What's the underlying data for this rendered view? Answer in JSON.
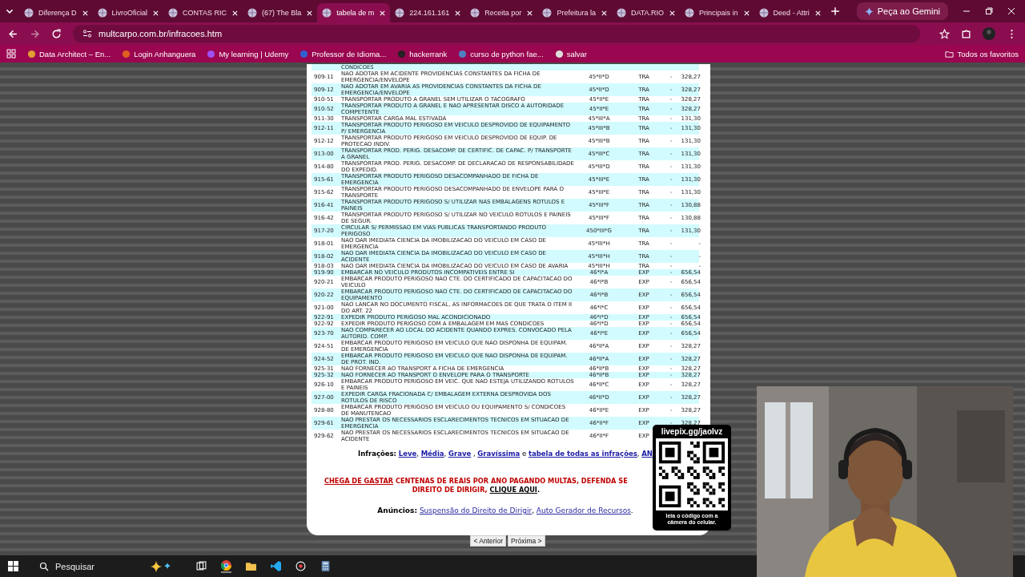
{
  "browser": {
    "tabs": [
      {
        "title": "Diferença D",
        "selected": false
      },
      {
        "title": "LivroOficial",
        "selected": false
      },
      {
        "title": "CONTAS RIC",
        "selected": false
      },
      {
        "title": "(67) The Bla",
        "selected": false
      },
      {
        "title": "tabela de m",
        "selected": true
      },
      {
        "title": "224.161.161",
        "selected": false
      },
      {
        "title": "Receita por",
        "selected": false
      },
      {
        "title": "Prefeitura la",
        "selected": false
      },
      {
        "title": "DATA.RIO",
        "selected": false
      },
      {
        "title": "Principais in",
        "selected": false
      },
      {
        "title": "Deed - Attri",
        "selected": false
      }
    ],
    "gemini_button": "Peça ao Gemini",
    "address": "multcarpo.com.br/infracoes.htm",
    "bookmarks": [
      "Data Architect – En...",
      "Login Anhanguera",
      "My learning | Udemy",
      "Professor de Idioma...",
      "hackerrank",
      "curso de python fae...",
      "salvar"
    ],
    "all_bookmarks": "Todos os favoritos"
  },
  "page": {
    "partial_line": "CONDICOES",
    "rows": [
      {
        "code": "909-11",
        "description": "NAO ADOTAR EM ACIDENTE PROVIDENCIAS CONSTANTES DA FICHA DE EMERGENCIA/ENVELOPE",
        "article": "45*II*D",
        "column_4": "TRA",
        "column_5": "-",
        "value": "328,27"
      },
      {
        "code": "909-12",
        "description": "NAO ADOTAR EM AVARIA AS PROVIDENCIAS CONSTANTES DA FICHA DE EMERGENCIA/ENVELOPE",
        "article": "45*II*D",
        "column_4": "TRA",
        "column_5": "-",
        "value": "328,27"
      },
      {
        "code": "910-51",
        "description": "TRANSPORTAR PRODUTO A GRANEL SEM UTILIZAR O TACOGRAFO",
        "article": "45*II*E",
        "column_4": "TRA",
        "column_5": "-",
        "value": "328,27"
      },
      {
        "code": "910-52",
        "description": "TRANSPORTAR PRODUTO A GRANEL E NAO APRESENTAR DISCO A AUTORIDADE COMPETENTE",
        "article": "45*II*E",
        "column_4": "TRA",
        "column_5": "-",
        "value": "328,27"
      },
      {
        "code": "911-30",
        "description": "TRANSPORTAR CARGA MAL ESTIVADA",
        "article": "45*III*A",
        "column_4": "TRA",
        "column_5": "-",
        "value": "131,30"
      },
      {
        "code": "912-11",
        "description": "TRANSPORTAR PRODUTO PERIGOSO EM VEICULO DESPROVIDO DE EQUIPAMENTO P/ EMERGENCIA",
        "article": "45*III*B",
        "column_4": "TRA",
        "column_5": "-",
        "value": "131,30"
      },
      {
        "code": "912-12",
        "description": "TRANSPORTAR PRODUTO PERIGOSO EM VEICULO DESPROVIDO DE EQUIP. DE PROTECAO INDIV.",
        "article": "45*III*B",
        "column_4": "TRA",
        "column_5": "-",
        "value": "131,30"
      },
      {
        "code": "913-00",
        "description": "TRANSPORTAR PROD. PERIG. DESACOMP. DE CERTIFIC. DE CAPAC. P/ TRANSPORTE A GRANEL",
        "article": "45*III*C",
        "column_4": "TRA",
        "column_5": "-",
        "value": "131,30"
      },
      {
        "code": "914-80",
        "description": "TRANSPORTAR PROD. PERIG. DESACOMP. DE DECLARACAO DE RESPONSABILIDADE DO EXPEDID.",
        "article": "45*III*D",
        "column_4": "TRA",
        "column_5": "-",
        "value": "131,30"
      },
      {
        "code": "915-61",
        "description": "TRANSPORTAR PRODUTO PERIGOSO DESACOMPANHADO DE FICHA DE EMERGENCIA",
        "article": "45*III*E",
        "column_4": "TRA",
        "column_5": "-",
        "value": "131,30"
      },
      {
        "code": "915-62",
        "description": "TRANSPORTAR PRODUTO PERIGOSO DESACOMPANHADO DE ENVELOPE PARA O TRANSPORTE",
        "article": "45*III*E",
        "column_4": "TRA",
        "column_5": "-",
        "value": "131,30"
      },
      {
        "code": "916-41",
        "description": "TRANSPORTAR PRODUTO PERIGOSO S/ UTILIZAR NAS EMBALAGENS ROTULOS E PAINEIS",
        "article": "45*III*F",
        "column_4": "TRA",
        "column_5": "-",
        "value": "130,88"
      },
      {
        "code": "916-42",
        "description": "TRANSPORTAR PRODUTO PERIGOSO S/ UTILIZAR NO VEICULO ROTULOS E PAINEIS DE SEGUR.",
        "article": "45*III*F",
        "column_4": "TRA",
        "column_5": "-",
        "value": "130,88"
      },
      {
        "code": "917-20",
        "description": "CIRCULAR S/ PERMISSAO EM VIAS PUBLICAS TRANSPORTANDO PRODUTO PERIGOSO",
        "article": "450*III*G",
        "column_4": "TRA",
        "column_5": "-",
        "value": "131,30"
      },
      {
        "code": "918-01",
        "description": "NAO DAR IMEDIATA CIENCIA DA IMOBILIZACAO DO VEICULO EM CASO DE EMERGENCIA",
        "article": "45*III*H",
        "column_4": "TRA",
        "column_5": "-",
        "value": "-"
      },
      {
        "code": "918-02",
        "description": "NAO DAR IMEDIATA CIENCIA DA IMOBILIZACAO DO VEICULO EM CASO DE ACIDENTE",
        "article": "45*III*H",
        "column_4": "TRA",
        "column_5": "-",
        "value": "-"
      },
      {
        "code": "918-03",
        "description": "NAO DAR IMEDIATA CIENCIA DA IMOBILIZACAO DO VEICULO EM CASO DE AVARIA",
        "article": "45*III*H",
        "column_4": "TRA",
        "column_5": "-",
        "value": "-"
      },
      {
        "code": "919-90",
        "description": "EMBARCAR NO VEICULO PRODUTOS INCOMPATIVEIS ENTRE SI",
        "article": "46*I*A",
        "column_4": "EXP",
        "column_5": "-",
        "value": "656,54"
      },
      {
        "code": "920-21",
        "description": "EMBARCAR PRODUTO PERIGOSO NAO CTE. DO CERTIFICADO DE CAPACITACAO DO VEICULO",
        "article": "46*I*B",
        "column_4": "EXP",
        "column_5": "-",
        "value": "656,54"
      },
      {
        "code": "920-22",
        "description": "EMBARCAR PRODUTO PERIGOSO NAO CTE. DO CERTIFICADO DE CAPACITACAO DO EQUIPAMENTO",
        "article": "46*I*B",
        "column_4": "EXP",
        "column_5": "-",
        "value": "656,54"
      },
      {
        "code": "921-00",
        "description": "NAO LANCAR NO DOCUMENTO FISCAL, AS INFORMACOES DE QUE TRATA O ITEM II DO ART. 22",
        "article": "46*I*C",
        "column_4": "EXP",
        "column_5": "-",
        "value": "656,54"
      },
      {
        "code": "922-91",
        "description": "EXPEDIR PRODUTO PERIGOSO MAL ACONDICIONADO",
        "article": "46*I*D",
        "column_4": "EXP",
        "column_5": "-",
        "value": "656,54"
      },
      {
        "code": "922-92",
        "description": "EXPEDIR PRODUTO PERIGOSO COM A EMBALAGEM EM MAS CONDICOES",
        "article": "46*I*D",
        "column_4": "EXP",
        "column_5": "-",
        "value": "656,54"
      },
      {
        "code": "923-70",
        "description": "NAO COMPARECER AO LOCAL DO ACIDENTE QUANDO EXPRES. CONVOCADO PELA AUTORID. COMP.",
        "article": "46*I*E",
        "column_4": "EXP",
        "column_5": "-",
        "value": "656,54"
      },
      {
        "code": "924-51",
        "description": "EMBARCAR PRODUTO PERIGOSO EM VEICULO QUE NAO DISPONHA DE EQUIPAM. DE EMERGENCIA",
        "article": "46*II*A",
        "column_4": "EXP",
        "column_5": "-",
        "value": "328,27"
      },
      {
        "code": "924-52",
        "description": "EMBARCAR PRODUTO PERIGOSO EM VEICULO QUE NAO DISPONHA DE EQUIPAM. DE PROT. IND.",
        "article": "46*II*A",
        "column_4": "EXP",
        "column_5": "-",
        "value": "328,27"
      },
      {
        "code": "925-31",
        "description": "NAO FORNECER AO TRANSPORT A FICHA DE EMERGENCIA",
        "article": "46*II*B",
        "column_4": "EXP",
        "column_5": "-",
        "value": "328,27"
      },
      {
        "code": "925-32",
        "description": "NAO FORNECER AO TRANSPORT O ENVELOPE PARA O TRANSPORTE",
        "article": "46*II*B",
        "column_4": "EXP",
        "column_5": "-",
        "value": "328,27"
      },
      {
        "code": "926-10",
        "description": "EMBARCAR PRODUTO PERIGOSO EM VEIC. QUE NAO ESTEJA UTILIZANDO ROTULOS E PAINEIS",
        "article": "46*II*C",
        "column_4": "EXP",
        "column_5": "-",
        "value": "328,27"
      },
      {
        "code": "927-00",
        "description": "EXPEDIR CARGA FRACIONADA C/ EMBALAGEM EXTERNA DESPROVIDA DOS ROTULOS DE RISCO",
        "article": "46*II*D",
        "column_4": "EXP",
        "column_5": "-",
        "value": "328,27"
      },
      {
        "code": "928-80",
        "description": "EMBARCAR PRODUTO PERIGOSO EM VEICULO OU EQUIPAMENTO S/ CONDICOES DE MANUTENCAO",
        "article": "46*II*E",
        "column_4": "EXP",
        "column_5": "-",
        "value": "328,27"
      },
      {
        "code": "929-61",
        "description": "NAO PRESTAR OS NECESSARIOS ESCLARECIMENTOS TECNICOS EM SITUACAO DE EMERGENCIA",
        "article": "46*II*F",
        "column_4": "EXP",
        "column_5": "-",
        "value": "328,27"
      },
      {
        "code": "929-62",
        "description": "NAO PRESTAR OS NECESSARIOS ESCLARECIMENTOS TECNICOS EM SITUACAO DE ACIDENTE",
        "article": "46*II*F",
        "column_4": "EXP"
      }
    ],
    "infractions": {
      "label": "Infrações:",
      "links": [
        {
          "text": "Leve",
          "after": ","
        },
        {
          "text": "Média",
          "after": ","
        },
        {
          "text": "Grave",
          "after": " ,"
        },
        {
          "text": "Gravíssima",
          "after": " e"
        },
        {
          "text": "tabela de todas as infrações",
          "after": ","
        },
        {
          "text": "AN"
        }
      ]
    },
    "promo": {
      "link": "CHEGA DE GASTAR",
      "text": "CENTENAS DE REAIS POR ANO PAGANDO MULTAS,  DEFENDA SE",
      "line2": "DIREITO DE DIRIGIR,",
      "action": "CLIQUE AQUI",
      "end": "."
    },
    "ads": {
      "label": "Anúncios:",
      "links": [
        "Suspensão do Direito de Dirigir",
        "Auto Gerador de Recursos"
      ],
      "separator": ",",
      "end": "."
    },
    "nav_buttons": [
      "< Anterior",
      "Próxima >"
    ]
  },
  "qr_overlay": {
    "url": "livepix.gg/jaolvz",
    "caption": "leia o código com a câmera do celular."
  },
  "taskbar": {
    "search_placeholder": "Pesquisar"
  }
}
